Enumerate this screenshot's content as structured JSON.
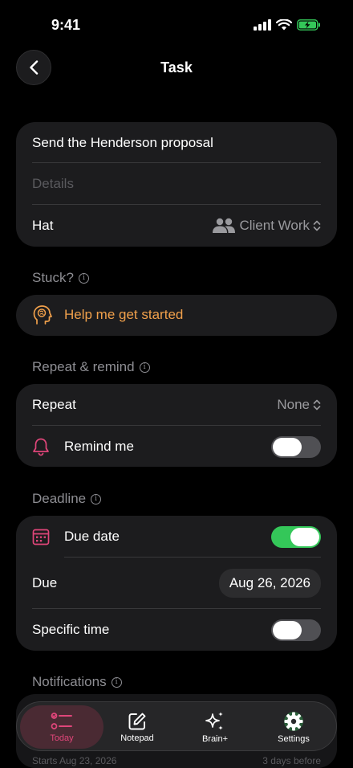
{
  "status": {
    "time": "9:41"
  },
  "nav": {
    "title": "Task"
  },
  "task": {
    "title": "Send the Henderson proposal",
    "details_placeholder": "Details",
    "hat_label": "Hat",
    "hat_value": "Client Work"
  },
  "stuck": {
    "label": "Stuck?",
    "action": "Help me get started"
  },
  "repeat_remind": {
    "label": "Repeat & remind",
    "repeat_label": "Repeat",
    "repeat_value": "None",
    "remind_label": "Remind me",
    "remind_on": false
  },
  "deadline": {
    "label": "Deadline",
    "due_date_label": "Due date",
    "due_date_on": true,
    "due_label": "Due",
    "due_value": "Aug 26, 2026",
    "specific_time_label": "Specific time",
    "specific_time_on": false
  },
  "notifications": {
    "label": "Notifications",
    "starts_text": "Starts Aug 23, 2026",
    "offset_text": "3 days before"
  },
  "tabs": [
    {
      "label": "Today",
      "icon": "checklist-icon",
      "active": true
    },
    {
      "label": "Notepad",
      "icon": "edit-icon",
      "active": false
    },
    {
      "label": "Brain+",
      "icon": "sparkles-icon",
      "active": false
    },
    {
      "label": "Settings",
      "icon": "gear-icon",
      "active": false
    }
  ],
  "colors": {
    "accent_orange": "#f0a04b",
    "accent_pink": "#e0467a",
    "toggle_on": "#34c759",
    "battery": "#34c759"
  }
}
